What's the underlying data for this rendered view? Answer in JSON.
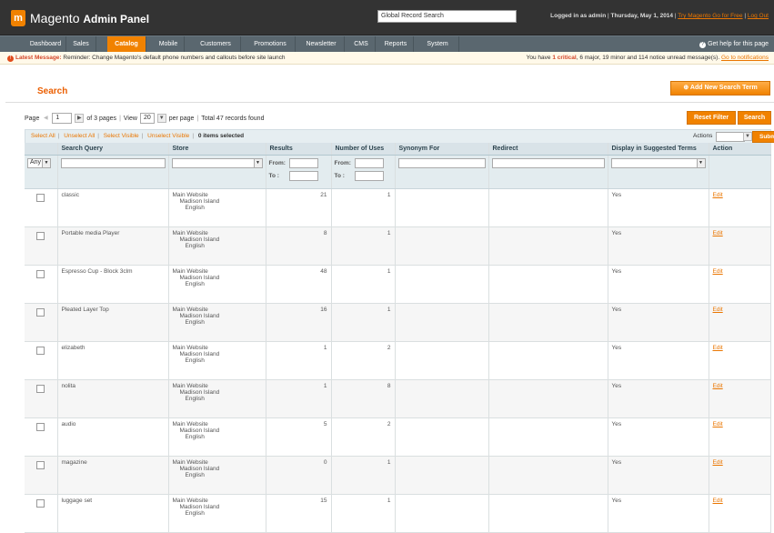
{
  "header": {
    "logo_mark": "m",
    "app_title": "Magento",
    "app_subtitle": "Admin Panel",
    "global_search_placeholder": "Global Record Search",
    "logged_in": "Logged in as admin",
    "date": "Thursday, May 1, 2014",
    "try_link": "Try Magento Go for Free",
    "logout": "Log Out"
  },
  "nav": {
    "items": [
      "Dashboard",
      "Sales",
      "Catalog",
      "Mobile",
      "Customers",
      "Promotions",
      "Newsletter",
      "CMS",
      "Reports",
      "System"
    ],
    "active": "Catalog",
    "help": "Get help for this page"
  },
  "notice": {
    "label": "Latest Message:",
    "text": "Reminder: Change Magento's default phone numbers and callouts before site launch",
    "summary_pre": "You have",
    "critical": "1 critical",
    "summary_post": ", 6 major, 19 minor and 114 notice unread message(s).",
    "link": "Go to notifications"
  },
  "page": {
    "title": "Search",
    "add_button": "Add New Search Term"
  },
  "pager": {
    "page_label": "Page",
    "page_value": "1",
    "of_pages": "of 3 pages",
    "view_label": "View",
    "per_page_value": "20",
    "per_page_label": "per page",
    "total": "Total 47 records found",
    "reset": "Reset Filter",
    "search": "Search"
  },
  "massaction": {
    "select_all": "Select All",
    "unselect_all": "Unselect All",
    "select_visible": "Select Visible",
    "unselect_visible": "Unselect Visible",
    "selected": "0 items selected",
    "actions_label": "Actions",
    "submit": "Submit"
  },
  "columns": [
    "",
    "Search Query",
    "Store",
    "Results",
    "Number of Uses",
    "Synonym For",
    "Redirect",
    "Display in Suggested Terms",
    "Action"
  ],
  "filters": {
    "any": "Any",
    "from": "From:",
    "to": "To :"
  },
  "store": {
    "line1": "Main Website",
    "line2": "Madison Island",
    "line3": "English"
  },
  "rows": [
    {
      "query": "classic",
      "results": "21",
      "uses": "1",
      "display": "Yes",
      "action": "Edit"
    },
    {
      "query": "Portable media Player",
      "results": "8",
      "uses": "1",
      "display": "Yes",
      "action": "Edit"
    },
    {
      "query": "Espresso Cup - Block 3clm",
      "results": "48",
      "uses": "1",
      "display": "Yes",
      "action": "Edit"
    },
    {
      "query": "Pleated Layer Top",
      "results": "16",
      "uses": "1",
      "display": "Yes",
      "action": "Edit"
    },
    {
      "query": "elizabeth",
      "results": "1",
      "uses": "2",
      "display": "Yes",
      "action": "Edit"
    },
    {
      "query": "nolita",
      "results": "1",
      "uses": "8",
      "display": "Yes",
      "action": "Edit"
    },
    {
      "query": "audio",
      "results": "5",
      "uses": "2",
      "display": "Yes",
      "action": "Edit"
    },
    {
      "query": "magazine",
      "results": "0",
      "uses": "1",
      "display": "Yes",
      "action": "Edit"
    },
    {
      "query": "luggage set",
      "results": "15",
      "uses": "1",
      "display": "Yes",
      "action": "Edit"
    }
  ]
}
